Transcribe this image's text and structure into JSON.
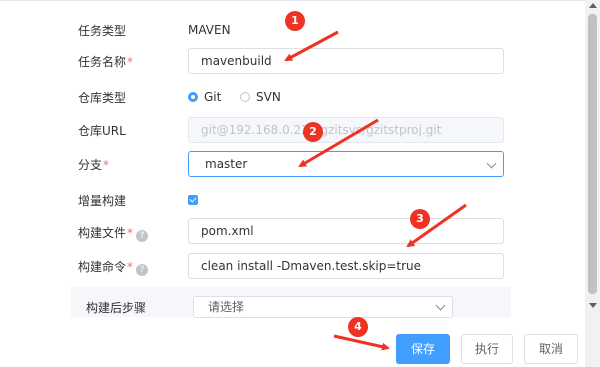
{
  "form": {
    "task_type_label": "任务类型",
    "task_type_value": "MAVEN",
    "task_name_label": "任务名称",
    "task_name_value": "mavenbuild",
    "repo_type_label": "仓库类型",
    "repo_options": [
      "Git",
      "SVN"
    ],
    "repo_selected": "Git",
    "repo_url_label": "仓库URL",
    "repo_url_value": "git@192.168.0.224:gzitsys/gzitstproj.git",
    "branch_label": "分支",
    "branch_value": "master",
    "incremental_label": "增量构建",
    "incremental_checked": true,
    "build_file_label": "构建文件",
    "build_file_value": "pom.xml",
    "build_cmd_label": "构建命令",
    "build_cmd_value": "clean install -Dmaven.test.skip=true",
    "post_steps_label": "构建后步骤",
    "post_steps_placeholder": "请选择",
    "required_mark": "*",
    "help_glyph": "?"
  },
  "buttons": {
    "save": "保存",
    "run": "执行",
    "cancel": "取消"
  },
  "annotations": {
    "badges": [
      "1",
      "2",
      "3",
      "4"
    ],
    "color": "#ee3324"
  },
  "colors": {
    "primary": "#409eff",
    "required": "#f56c6c"
  }
}
